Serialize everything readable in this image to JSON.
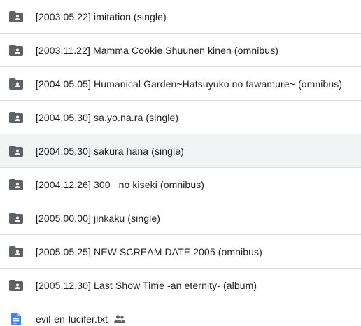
{
  "colors": {
    "folder_icon": "#5f6368",
    "doc_icon": "#4285f4",
    "selected_row": "#f1f3f4",
    "divider": "#dadce0",
    "text": "#202124"
  },
  "items": [
    {
      "name": "[2003.05.22] imitation (single)",
      "icon": "shared-folder-icon",
      "selected": false
    },
    {
      "name": "[2003.11.22] Mamma Cookie  Shuunen kinen (omnibus)",
      "icon": "shared-folder-icon",
      "selected": false
    },
    {
      "name": "[2004.05.05] Humanical Garden~Hatsuyuko no tawamure~ (omnibus)",
      "icon": "shared-folder-icon",
      "selected": false
    },
    {
      "name": "[2004.05.30] sa.yo.na.ra (single)",
      "icon": "shared-folder-icon",
      "selected": false
    },
    {
      "name": "[2004.05.30] sakura hana (single)",
      "icon": "shared-folder-icon",
      "selected": true
    },
    {
      "name": "[2004.12.26] 300_ no kiseki (omnibus)",
      "icon": "shared-folder-icon",
      "selected": false
    },
    {
      "name": "[2005.00.00] jinkaku (single)",
      "icon": "shared-folder-icon",
      "selected": false
    },
    {
      "name": "[2005.05.25] NEW SCREAM DATE 2005 (omnibus)",
      "icon": "shared-folder-icon",
      "selected": false
    },
    {
      "name": "[2005.12.30] Last Show Time -an eternity- (album)",
      "icon": "shared-folder-icon",
      "selected": false
    },
    {
      "name": "evil-en-lucifer.txt",
      "icon": "document-icon",
      "selected": false,
      "shared": true
    }
  ]
}
